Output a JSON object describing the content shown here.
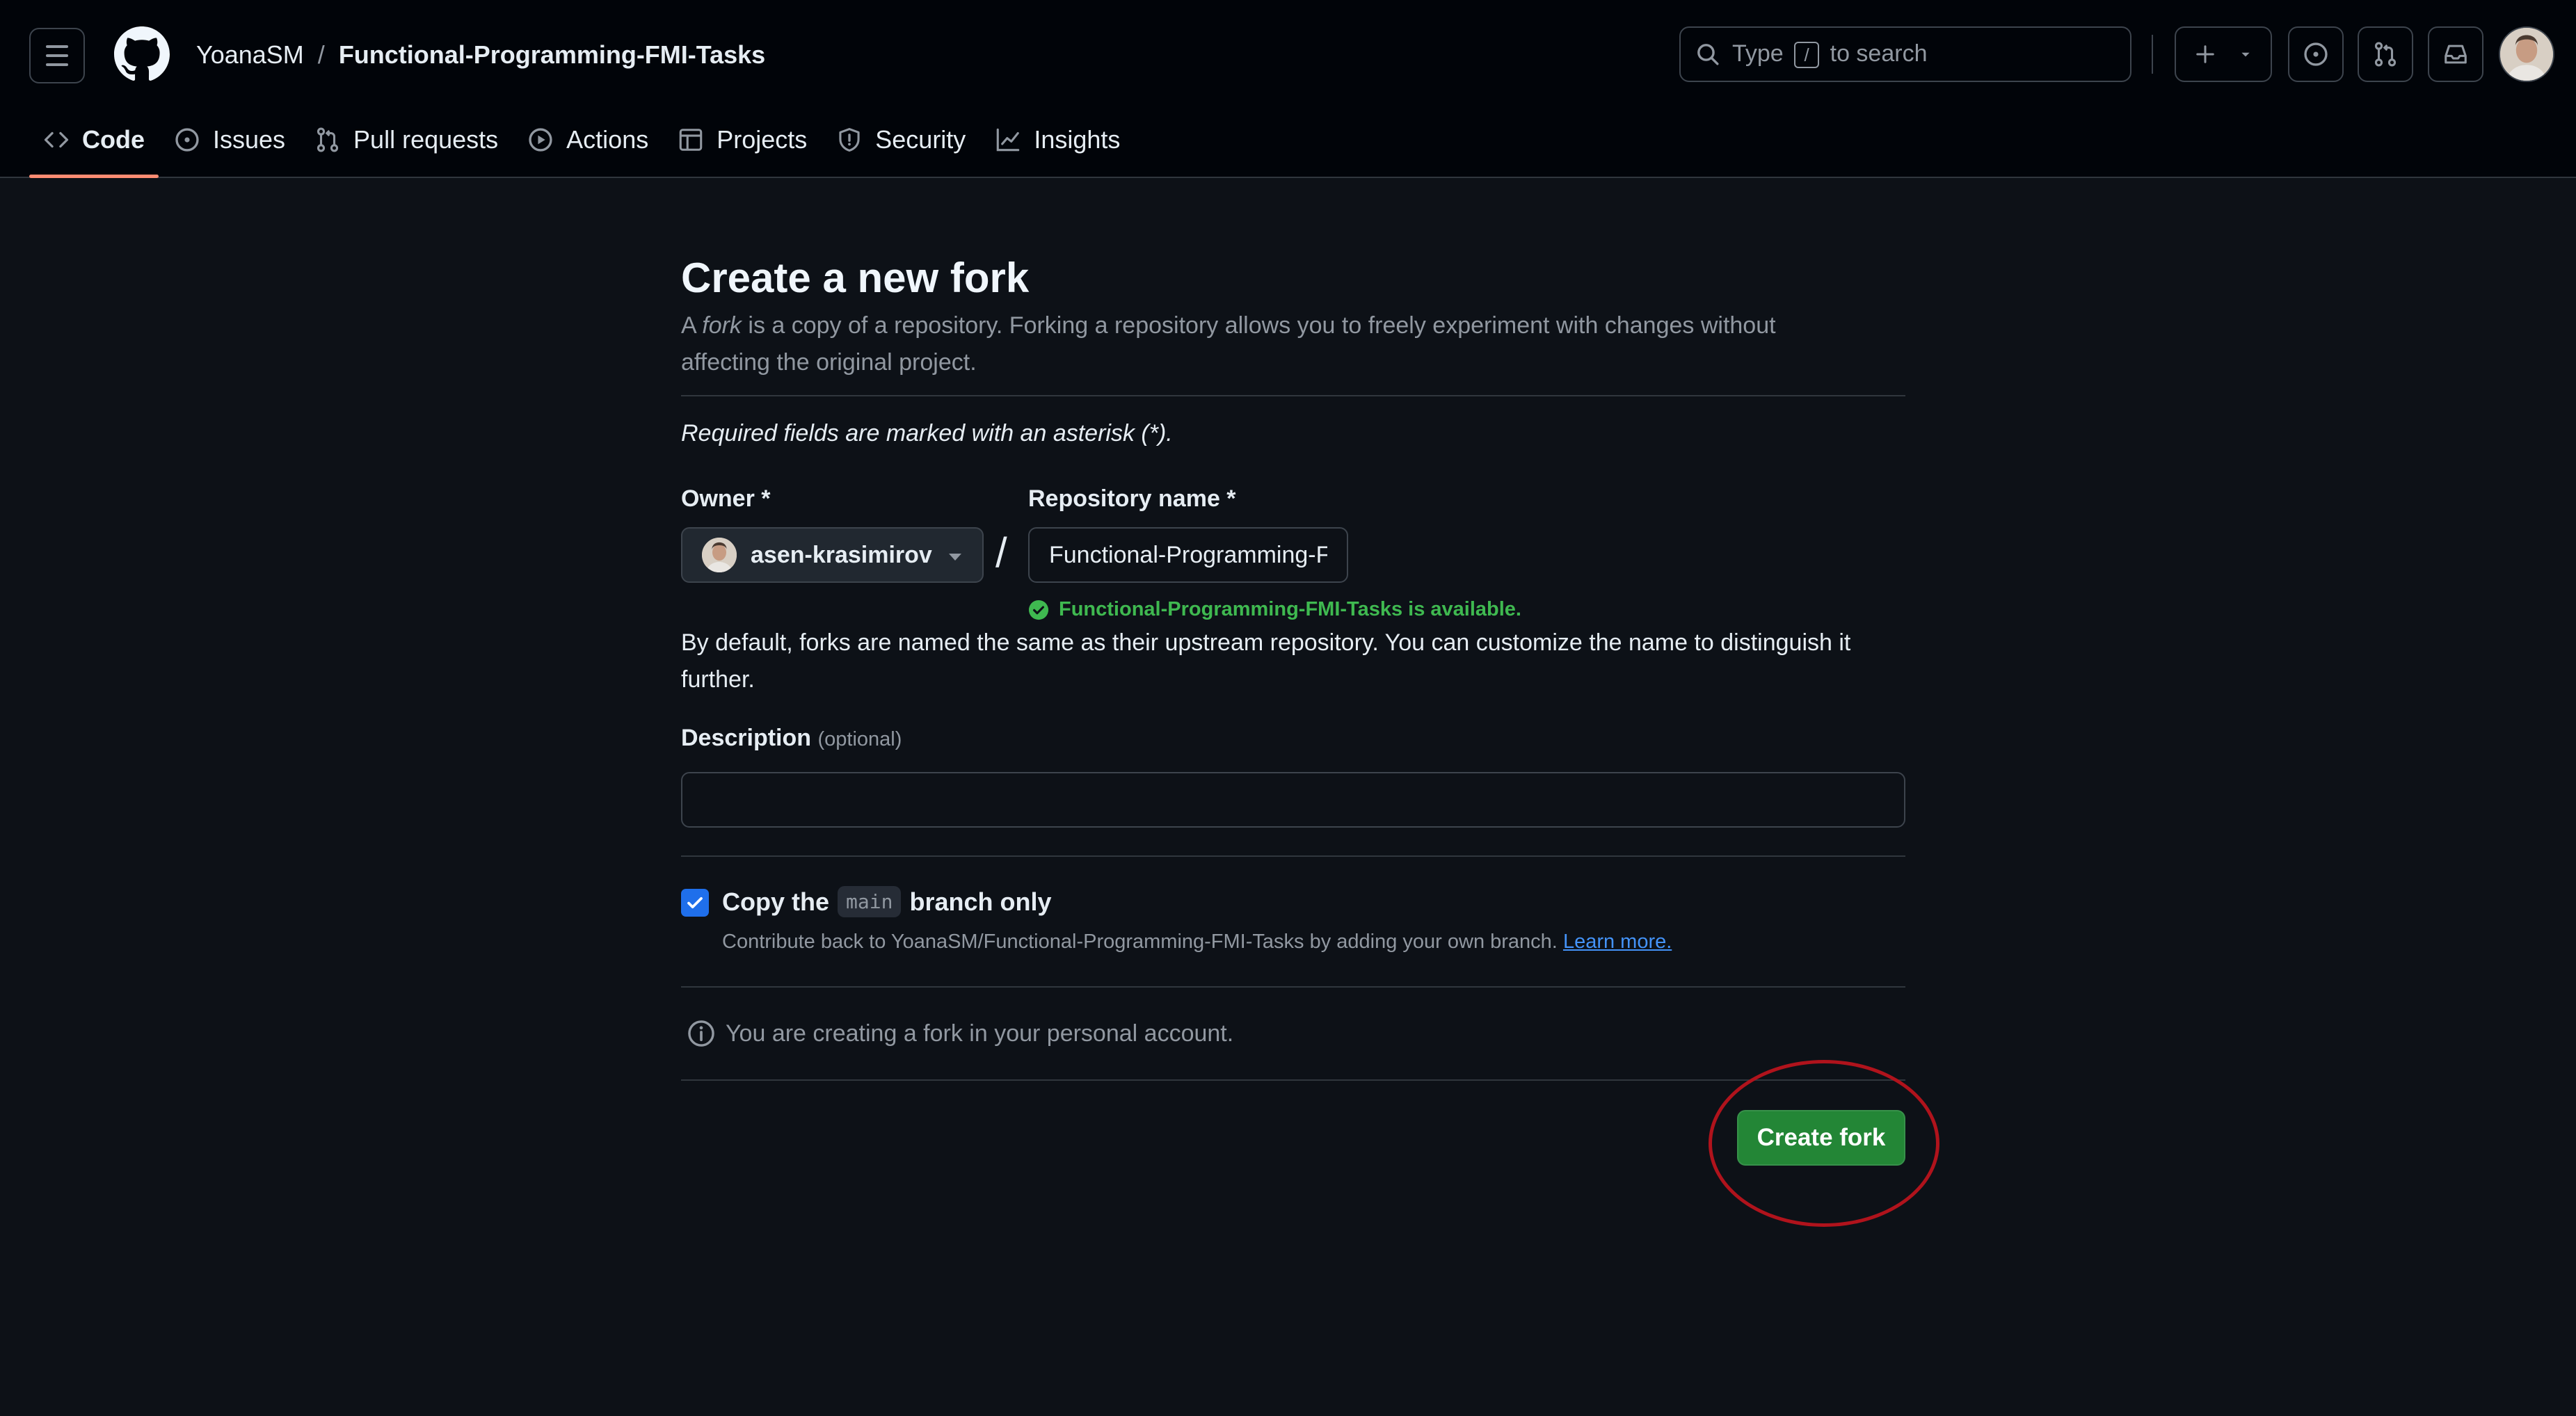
{
  "header": {
    "owner": "YoanaSM",
    "separator": "/",
    "repo": "Functional-Programming-FMI-Tasks",
    "search": {
      "prefix": "Type",
      "key": "/",
      "suffix": "to search"
    }
  },
  "nav": {
    "items": [
      {
        "label": "Code",
        "icon": "code-icon",
        "active": true
      },
      {
        "label": "Issues",
        "icon": "issue-opened-icon"
      },
      {
        "label": "Pull requests",
        "icon": "git-pull-request-icon"
      },
      {
        "label": "Actions",
        "icon": "play-icon"
      },
      {
        "label": "Projects",
        "icon": "table-icon"
      },
      {
        "label": "Security",
        "icon": "shield-icon"
      },
      {
        "label": "Insights",
        "icon": "graph-icon"
      }
    ]
  },
  "main": {
    "title": "Create a new fork",
    "subtitle_a": "A ",
    "subtitle_fork": "fork",
    "subtitle_b": " is a copy of a repository. Forking a repository allows you to freely experiment with changes without affecting the original project.",
    "required_note": "Required fields are marked with an asterisk (*).",
    "owner_label": "Owner *",
    "owner_value": "asen-krasimirov",
    "repo_name_label": "Repository name *",
    "repo_name_value": "Functional-Programming-FMI-Tasks",
    "availability": "Functional-Programming-FMI-Tasks is available.",
    "default_note": "By default, forks are named the same as their upstream repository. You can customize the name to distinguish it further.",
    "description_label": "Description",
    "description_optional": "(optional)",
    "description_value": "",
    "copy_branch": {
      "checked": true,
      "prefix": "Copy the",
      "branch": "main",
      "suffix": "branch only",
      "help": "Contribute back to YoanaSM/Functional-Programming-FMI-Tasks by adding your own branch.",
      "learn_more": "Learn more."
    },
    "info": "You are creating a fork in your personal account.",
    "create_button": "Create fork"
  },
  "colors": {
    "background": "#0d1117",
    "header": "#010409",
    "accent_underline": "#fd8c73",
    "success": "#3fb950",
    "primary_button": "#238636",
    "link": "#4493f8",
    "annotation_ellipse": "#b0131c"
  }
}
